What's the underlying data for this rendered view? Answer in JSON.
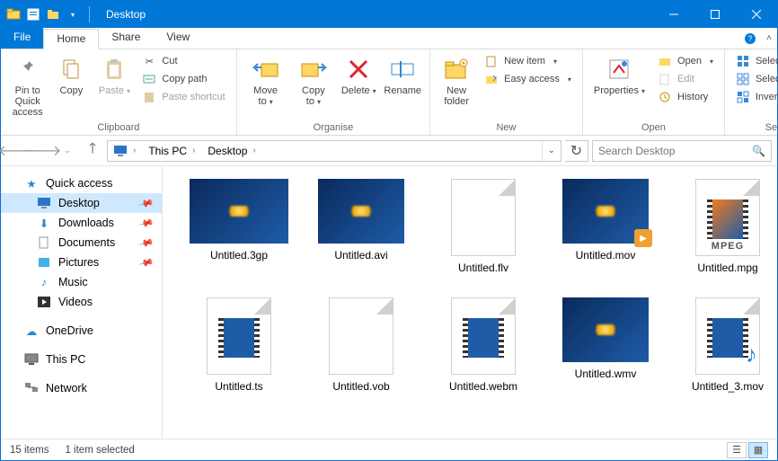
{
  "window": {
    "title": "Desktop"
  },
  "tabs": {
    "file": "File",
    "home": "Home",
    "share": "Share",
    "view": "View",
    "active": "Home"
  },
  "ribbon": {
    "clipboard": {
      "label": "Clipboard",
      "pin": "Pin to Quick access",
      "copy": "Copy",
      "paste": "Paste",
      "cut": "Cut",
      "copy_path": "Copy path",
      "paste_shortcut": "Paste shortcut"
    },
    "organise": {
      "label": "Organise",
      "move_to": "Move to",
      "copy_to": "Copy to",
      "delete": "Delete",
      "rename": "Rename"
    },
    "new": {
      "label": "New",
      "new_folder": "New folder",
      "new_item": "New item",
      "easy_access": "Easy access"
    },
    "open": {
      "label": "Open",
      "properties": "Properties",
      "open": "Open",
      "edit": "Edit",
      "history": "History"
    },
    "select": {
      "label": "Select",
      "select_all": "Select all",
      "select_none": "Select none",
      "invert": "Invert selection"
    }
  },
  "breadcrumb": {
    "root": "This PC",
    "leaf": "Desktop"
  },
  "search": {
    "placeholder": "Search Desktop"
  },
  "sidebar": {
    "quick_access": "Quick access",
    "desktop": "Desktop",
    "downloads": "Downloads",
    "documents": "Documents",
    "pictures": "Pictures",
    "music": "Music",
    "videos": "Videos",
    "onedrive": "OneDrive",
    "this_pc": "This PC",
    "network": "Network"
  },
  "files": [
    {
      "name": "Untitled.3gp",
      "thumb": "blue",
      "wide": true
    },
    {
      "name": "Untitled.avi",
      "thumb": "blue"
    },
    {
      "name": "Untitled.flv",
      "thumb": "blank"
    },
    {
      "name": "Untitled.mov",
      "thumb": "blue",
      "play": true
    },
    {
      "name": "Untitled.mpg",
      "thumb": "mpeg"
    },
    {
      "name": "Untitled.ts",
      "thumb": "strip"
    },
    {
      "name": "Untitled.vob",
      "thumb": "blank"
    },
    {
      "name": "Untitled.webm",
      "thumb": "strip"
    },
    {
      "name": "Untitled.wmv",
      "thumb": "blue"
    },
    {
      "name": "Untitled_3.mov",
      "thumb": "stripnote"
    }
  ],
  "status": {
    "count": "15 items",
    "selection": "1 item selected"
  }
}
